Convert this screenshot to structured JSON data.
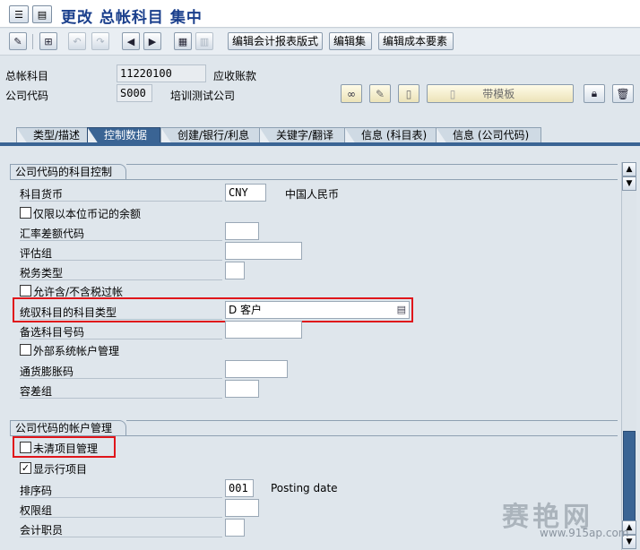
{
  "title": "更改 总帐科目 集中",
  "toolbar": {
    "edit_report_layout": "编辑会计报表版式",
    "edit_set": "编辑集",
    "edit_cost_element": "编辑成本要素"
  },
  "header": {
    "gl_account_label": "总帐科目",
    "gl_account_value": "11220100",
    "gl_account_desc": "应收账款",
    "company_code_label": "公司代码",
    "company_code_value": "S000",
    "company_code_desc": "培训测试公司",
    "template_button": "带模板"
  },
  "tabs": [
    {
      "label": "类型/描述"
    },
    {
      "label": "控制数据"
    },
    {
      "label": "创建/银行/利息"
    },
    {
      "label": "关键字/翻译"
    },
    {
      "label": "信息 (科目表)"
    },
    {
      "label": "信息 (公司代码)"
    }
  ],
  "account_control": {
    "title": "公司代码的科目控制",
    "account_currency_label": "科目货币",
    "account_currency_value": "CNY",
    "account_currency_desc": "中国人民币",
    "local_currency_only_label": "仅限以本位币记的余额",
    "exchange_rate_diff_label": "汇率差额代码",
    "valuation_group_label": "评估组",
    "tax_category_label": "税务类型",
    "posting_without_tax_label": "允许含/不含税过帐",
    "recon_account_label": "统驭科目的科目类型",
    "recon_account_value": "D 客户",
    "alt_account_label": "备选科目号码",
    "external_mgmt_label": "外部系统帐户管理",
    "inflation_key_label": "通货膨胀码",
    "tolerance_group_label": "容差组"
  },
  "account_management": {
    "title": "公司代码的帐户管理",
    "open_item_label": "未清项目管理",
    "open_item_checked": false,
    "line_items_label": "显示行项目",
    "line_items_checked": true,
    "sort_key_label": "排序码",
    "sort_key_value": "001",
    "sort_key_desc": "Posting date",
    "auth_group_label": "权限组",
    "accounting_clerk_label": "会计职员"
  },
  "watermark": {
    "text": "赛艳网",
    "url": "www.915ap.com"
  }
}
